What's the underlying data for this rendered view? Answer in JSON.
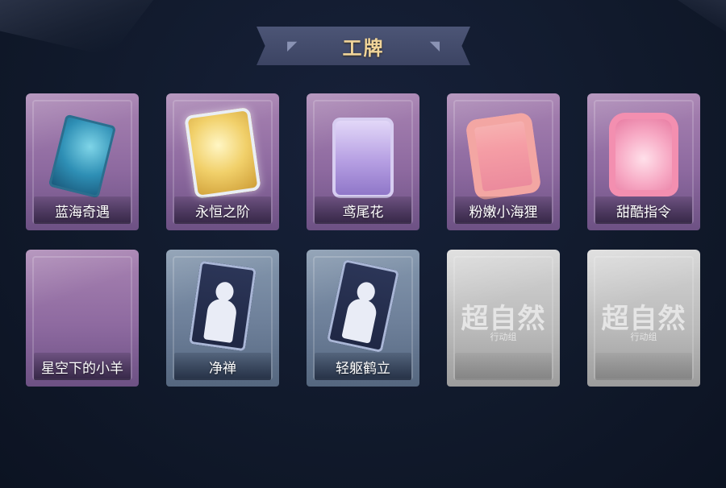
{
  "title": "工牌",
  "cards": [
    {
      "label": "蓝海奇遇",
      "icon": "blue-sea-card-art"
    },
    {
      "label": "永恒之阶",
      "icon": "golden-frame-art"
    },
    {
      "label": "鸢尾花",
      "icon": "iris-frame-art"
    },
    {
      "label": "粉嫩小海狸",
      "icon": "pink-seal-frame-art"
    },
    {
      "label": "甜酷指令",
      "icon": "pink-shark-frame-art"
    },
    {
      "label": "星空下的小羊",
      "icon": "empty-frame-art"
    },
    {
      "label": "净禅",
      "icon": "silhouette-card-art"
    },
    {
      "label": "轻躯鹤立",
      "icon": "silhouette-card-art"
    },
    {
      "label": "",
      "icon": "locked-placeholder",
      "logo": "超自然",
      "logo_sub": "行动组"
    },
    {
      "label": "",
      "icon": "locked-placeholder",
      "logo": "超自然",
      "logo_sub": "行动组"
    }
  ]
}
